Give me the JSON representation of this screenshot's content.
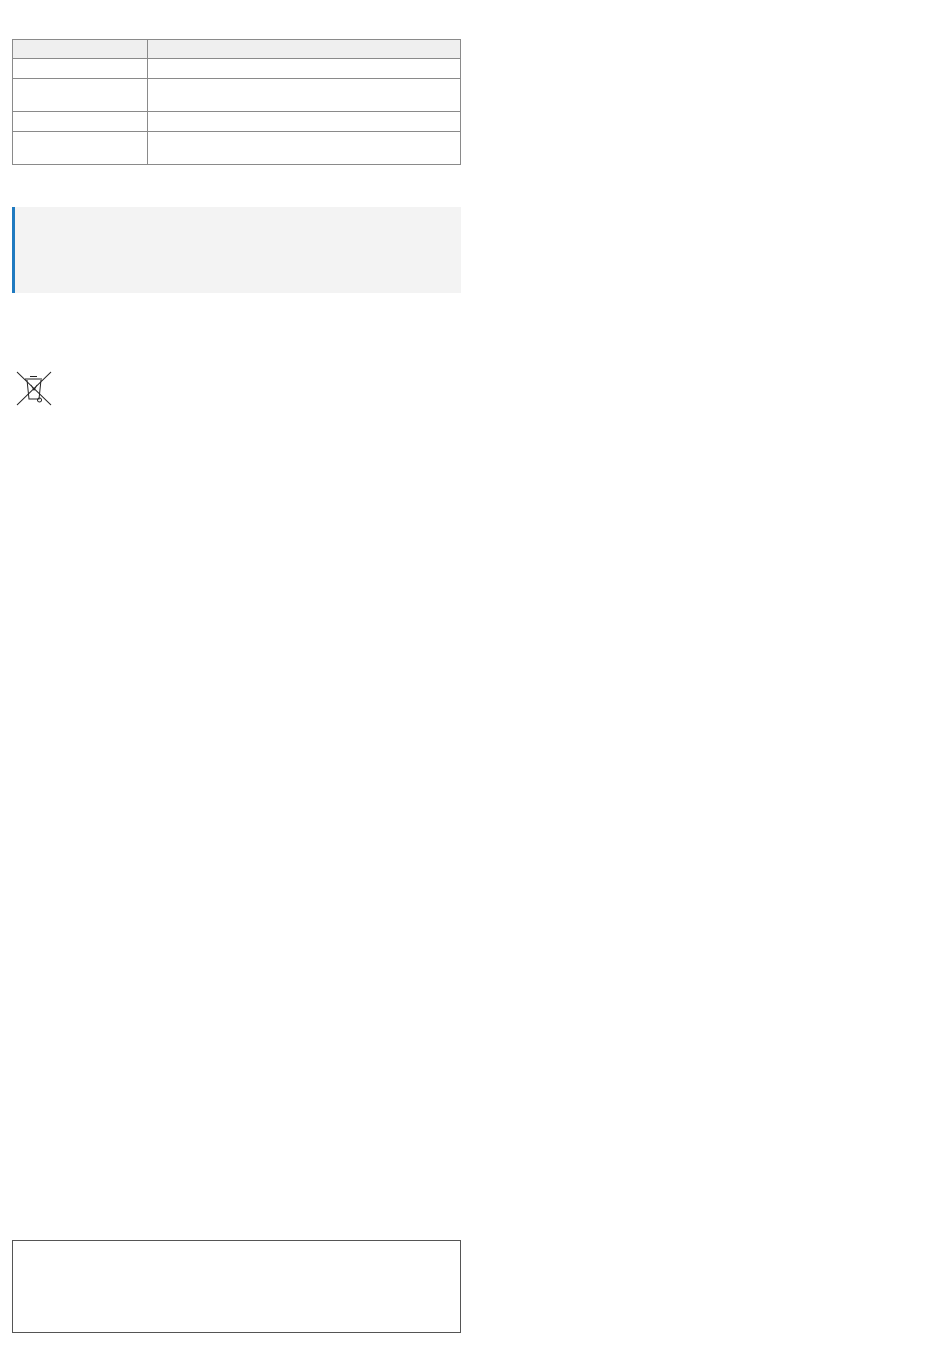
{
  "spec_table": {
    "header": [
      "",
      ""
    ],
    "rows": [
      [
        "",
        ""
      ],
      [
        "",
        ""
      ],
      [
        "",
        ""
      ],
      [
        "",
        ""
      ]
    ]
  },
  "note": {
    "text": "",
    "accent_color": "#1f7ac0"
  },
  "disposal": {
    "icon": "crossed-out-wheelie-bin-icon"
  },
  "footer_box": {
    "text": ""
  }
}
